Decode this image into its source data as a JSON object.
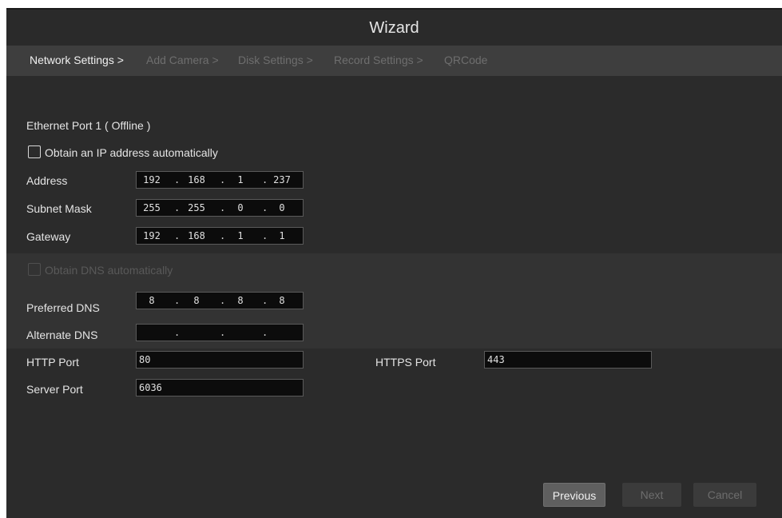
{
  "window": {
    "title": "Wizard"
  },
  "steps": [
    {
      "label": "Network Settings >",
      "active": true
    },
    {
      "label": "Add Camera >",
      "active": false
    },
    {
      "label": "Disk Settings >",
      "active": false
    },
    {
      "label": "Record Settings >",
      "active": false
    },
    {
      "label": "QRCode",
      "active": false
    }
  ],
  "network": {
    "port_label": "Ethernet Port 1 ( Offline )",
    "obtain_ip": {
      "label": "Obtain an IP address automatically",
      "checked": false
    },
    "address": {
      "label": "Address",
      "octets": [
        "192",
        "168",
        "1",
        "237"
      ]
    },
    "subnet_mask": {
      "label": "Subnet Mask",
      "octets": [
        "255",
        "255",
        "0",
        "0"
      ]
    },
    "gateway": {
      "label": "Gateway",
      "octets": [
        "192",
        "168",
        "1",
        "1"
      ]
    },
    "obtain_dns": {
      "label": "Obtain DNS automatically",
      "checked": false,
      "enabled": false
    },
    "preferred_dns": {
      "label": "Preferred DNS",
      "octets": [
        "8",
        "8",
        "8",
        "8"
      ]
    },
    "alternate_dns": {
      "label": "Alternate DNS",
      "octets": [
        "",
        "",
        "",
        ""
      ]
    },
    "http_port": {
      "label": "HTTP Port",
      "value": "80"
    },
    "https_port": {
      "label": "HTTPS Port",
      "value": "443"
    },
    "server_port": {
      "label": "Server Port",
      "value": "6036"
    }
  },
  "buttons": {
    "previous": "Previous",
    "next": "Next",
    "cancel": "Cancel"
  },
  "colors": {
    "background": "#2b2b2b",
    "step_bar": "#3e3e3e",
    "field_bg": "#0c0c0c",
    "active_text": "#f0f0f0",
    "inactive_text": "#6e6e6e"
  }
}
